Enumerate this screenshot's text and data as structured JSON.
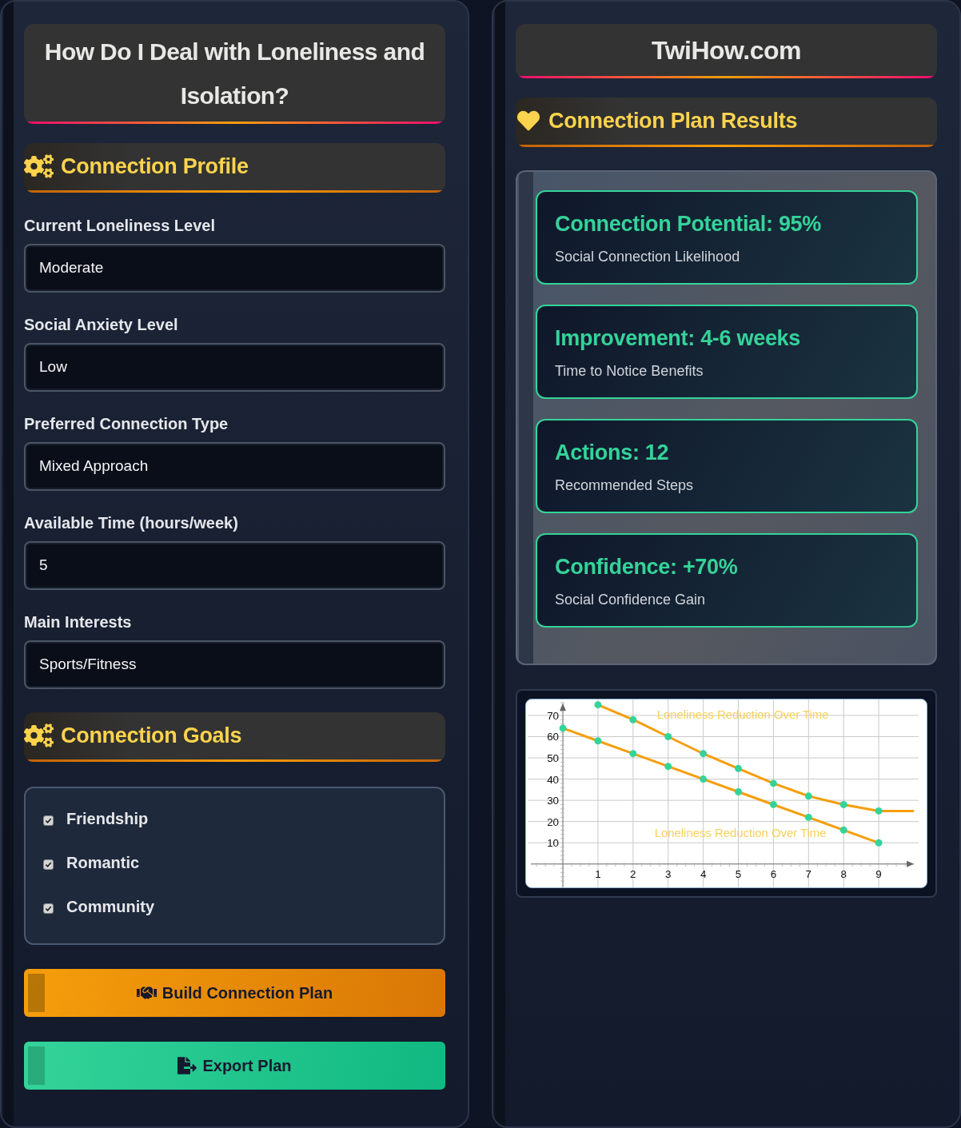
{
  "left_panel": {
    "title": "How Do I Deal with Loneliness and Isolation?",
    "profile_header": "Connection Profile",
    "fields": [
      {
        "label": "Current Loneliness Level",
        "value": "Moderate"
      },
      {
        "label": "Social Anxiety Level",
        "value": "Low"
      },
      {
        "label": "Preferred Connection Type",
        "value": "Mixed Approach"
      },
      {
        "label": "Available Time (hours/week)",
        "value": "5"
      },
      {
        "label": "Main Interests",
        "value": "Sports/Fitness"
      }
    ],
    "goals_header": "Connection Goals",
    "goals": [
      {
        "label": "Friendship",
        "checked": true
      },
      {
        "label": "Romantic",
        "checked": true
      },
      {
        "label": "Community",
        "checked": true
      }
    ],
    "buttons": [
      {
        "label": "Build Connection Plan",
        "kind": "build"
      },
      {
        "label": "Export Plan",
        "kind": "export"
      }
    ]
  },
  "right_panel": {
    "site_title": "TwiHow.com",
    "results_header": "Connection Plan Results",
    "results": [
      {
        "value": "Connection Potential: 95%",
        "caption": "Social Connection Likelihood"
      },
      {
        "value": "Improvement: 4-6 weeks",
        "caption": "Time to Notice Benefits"
      },
      {
        "value": "Actions: 12",
        "caption": "Recommended Steps"
      },
      {
        "value": "Confidence: +70%",
        "caption": "Social Confidence Gain"
      }
    ],
    "chart": {
      "chart_data": {
        "type": "line",
        "grid": true,
        "x": [
          0,
          1,
          2,
          3,
          4,
          5,
          6,
          7,
          8,
          9,
          10
        ],
        "series": [
          {
            "name": "Loneliness Reduction Over Time",
            "color": "#f59e0b",
            "marker": "circle",
            "values": [
              null,
              75,
              68,
              60,
              52,
              45,
              38,
              32,
              28,
              25,
              25
            ]
          },
          {
            "name": "Loneliness Reduction Over Time",
            "color": "#f59e0b",
            "marker": "circle",
            "values": [
              64,
              58,
              52,
              46,
              40,
              34,
              28,
              22,
              16,
              10,
              null
            ]
          }
        ],
        "xlim": [
          -1,
          10
        ],
        "ylim": [
          -11,
          77.5
        ],
        "xticks": [
          1,
          2,
          3,
          4,
          5,
          6,
          7,
          8,
          9
        ],
        "yticks": [
          10,
          20,
          30,
          40,
          50,
          60,
          70
        ]
      }
    }
  }
}
